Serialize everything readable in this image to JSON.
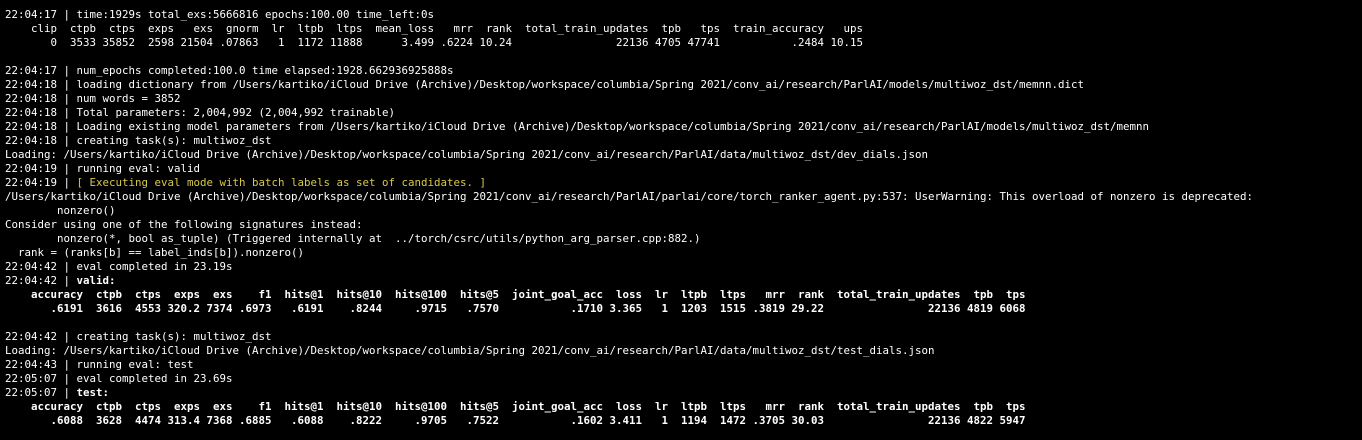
{
  "colors": {
    "background": "#000000",
    "text": "#ffffff",
    "highlight": "#d7c94a"
  },
  "terminal": {
    "train_status": "22:04:17 | time:1929s total_exs:5666816 epochs:100.00 time_left:0s",
    "train_header": "    clip  ctpb  ctps  exps   exs  gnorm  lr  ltpb  ltps  mean_loss   mrr  rank  total_train_updates  tpb   tps  train_accuracy   ups",
    "train_values": "       0  3533 35852  2598 21504 .07863   1  1172 11888      3.499 .6224 10.24                22136 4705 47741           .2484 10.15",
    "num_epochs": "22:04:17 | num_epochs completed:100.0 time elapsed:1928.662936925888s",
    "loading_dict": "22:04:18 | loading dictionary from /Users/kartiko/iCloud Drive (Archive)/Desktop/workspace/columbia/Spring 2021/conv_ai/research/ParlAI/models/multiwoz_dst/memnn.dict",
    "num_words": "22:04:18 | num words = 3852",
    "total_params": "22:04:18 | Total parameters: 2,004,992 (2,004,992 trainable)",
    "loading_model": "22:04:18 | Loading existing model parameters from /Users/kartiko/iCloud Drive (Archive)/Desktop/workspace/columbia/Spring 2021/conv_ai/research/ParlAI/models/multiwoz_dst/memnn",
    "creating_task_valid": "22:04:18 | creating task(s): multiwoz_dst",
    "loading_dev": "Loading: /Users/kartiko/iCloud Drive (Archive)/Desktop/workspace/columbia/Spring 2021/conv_ai/research/ParlAI/data/multiwoz_dst/dev_dials.json",
    "running_eval_valid": "22:04:19 | running eval: valid",
    "executing_prefix": "22:04:19 | ",
    "executing_msg": "[ Executing eval mode with batch labels as set of candidates. ]",
    "warning_line1": "/Users/kartiko/iCloud Drive (Archive)/Desktop/workspace/columbia/Spring 2021/conv_ai/research/ParlAI/parlai/core/torch_ranker_agent.py:537: UserWarning: This overload of nonzero is deprecated:",
    "warning_line2": "        nonzero()",
    "warning_line3": "Consider using one of the following signatures instead:",
    "warning_line4": "        nonzero(*, bool as_tuple) (Triggered internally at  ../torch/csrc/utils/python_arg_parser.cpp:882.)",
    "warning_line5": "  rank = (ranks[b] == label_inds[b]).nonzero()",
    "eval_completed_valid": "22:04:42 | eval completed in 23.19s",
    "valid_prefix": "22:04:42 | ",
    "valid_label": "valid:",
    "valid_header": "    accuracy  ctpb  ctps  exps  exs    f1  hits@1  hits@10  hits@100  hits@5  joint_goal_acc  loss  lr  ltpb  ltps   mrr  rank  total_train_updates  tpb  tps",
    "valid_values": "       .6191  3616  4553 320.2 7374 .6973   .6191    .8244     .9715   .7570           .1710 3.365   1  1203  1515 .3819 29.22                22136 4819 6068",
    "creating_task_test": "22:04:42 | creating task(s): multiwoz_dst",
    "loading_test": "Loading: /Users/kartiko/iCloud Drive (Archive)/Desktop/workspace/columbia/Spring 2021/conv_ai/research/ParlAI/data/multiwoz_dst/test_dials.json",
    "running_eval_test": "22:04:43 | running eval: test",
    "eval_completed_test": "22:05:07 | eval completed in 23.69s",
    "test_prefix": "22:05:07 | ",
    "test_label": "test:",
    "test_header": "    accuracy  ctpb  ctps  exps  exs    f1  hits@1  hits@10  hits@100  hits@5  joint_goal_acc  loss  lr  ltpb  ltps   mrr  rank  total_train_updates  tpb  tps",
    "test_values": "       .6088  3628  4474 313.4 7368 .6885   .6088    .8222     .9705   .7522           .1602 3.411   1  1194  1472 .3705 30.03                22136 4822 5947"
  }
}
